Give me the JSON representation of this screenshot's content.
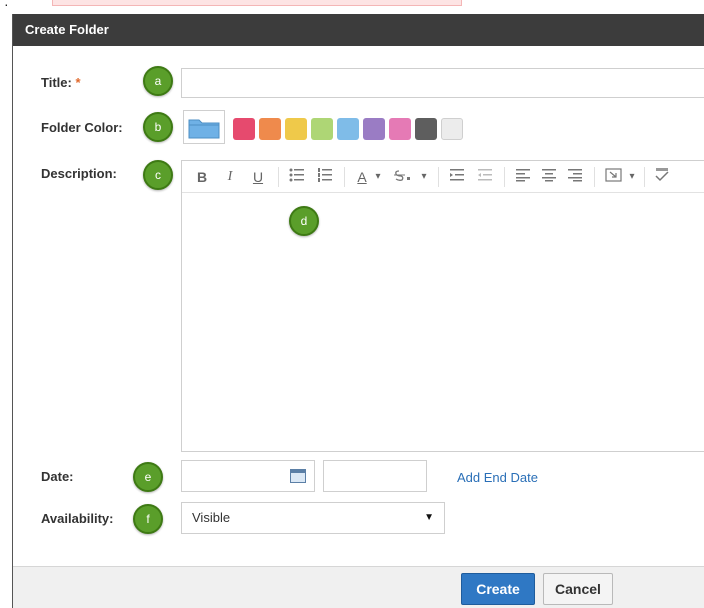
{
  "dialog": {
    "title": "Create Folder"
  },
  "form": {
    "title_label": "Title:",
    "required_mark": "*",
    "title_value": "",
    "folder_color_label": "Folder Color:",
    "colors": [
      "#e64a6e",
      "#ef8a4c",
      "#efc94a",
      "#aed675",
      "#7fbce8",
      "#9a7cc4",
      "#e57ab5",
      "#5e5e5e",
      "#ececec"
    ],
    "selected_folder_color": "#6fb1e6",
    "description_label": "Description:",
    "date_label": "Date:",
    "add_end_date": "Add End Date",
    "availability_label": "Availability:",
    "availability_value": "Visible"
  },
  "markers": {
    "a": "a",
    "b": "b",
    "c": "c",
    "d": "d",
    "e": "e",
    "f": "f"
  },
  "toolbar": {
    "bold": "B",
    "italic": "I",
    "underline": "U",
    "font_color": "A",
    "dropdown": "▾"
  },
  "footer": {
    "create_label": "Create",
    "cancel_label": "Cancel"
  }
}
